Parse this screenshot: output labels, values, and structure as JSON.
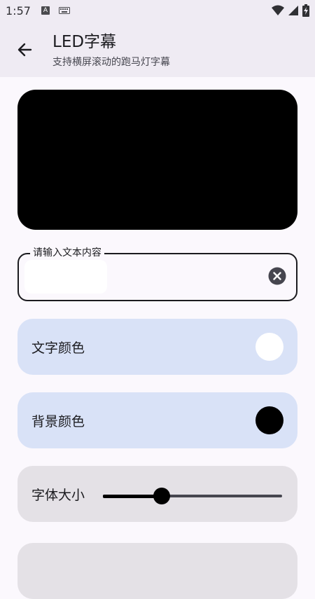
{
  "status_bar": {
    "time": "1:57",
    "notification_icon": "a-letter-icon",
    "keyboard_icon": "keyboard-icon",
    "wifi_icon": "wifi-icon",
    "signal_icon": "cell-signal-icon",
    "battery_icon": "battery-charging-icon"
  },
  "app_bar": {
    "back_icon": "arrow-back-icon",
    "title": "LED字幕",
    "subtitle": "支持横屏滚动的跑马灯字幕"
  },
  "preview": {
    "background_color": "#000000"
  },
  "text_input": {
    "label": "请输入文本内容",
    "value": "",
    "clear_icon": "cancel-circle-icon"
  },
  "settings": {
    "text_color": {
      "label": "文字颜色",
      "value": "#ffffff"
    },
    "background_color": {
      "label": "背景颜色",
      "value": "#000000"
    },
    "font_size": {
      "label": "字体大小",
      "value_fraction": 0.33
    }
  },
  "colors": {
    "accent_card": "#d9e2f7",
    "neutral_card": "#e4e1e6",
    "app_bar": "#efebf3",
    "page": "#fbf8fd"
  }
}
